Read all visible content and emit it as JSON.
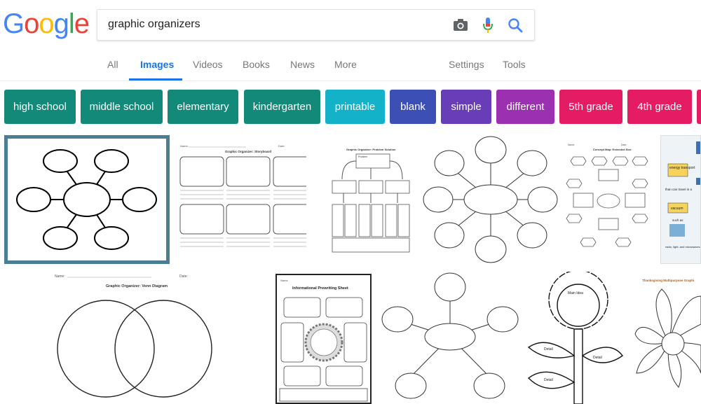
{
  "logo": {
    "letters": [
      "G",
      "o",
      "o",
      "g",
      "l",
      "e"
    ],
    "colors": [
      "#4285F4",
      "#EA4335",
      "#FBBC05",
      "#4285F4",
      "#34A853",
      "#EA4335"
    ]
  },
  "search": {
    "query": "graphic organizers"
  },
  "tabs": [
    {
      "label": "All"
    },
    {
      "label": "Images"
    },
    {
      "label": "Videos"
    },
    {
      "label": "Books"
    },
    {
      "label": "News"
    },
    {
      "label": "More"
    },
    {
      "label": "Settings"
    },
    {
      "label": "Tools"
    }
  ],
  "chips": [
    {
      "label": "high school",
      "color": "#13897a"
    },
    {
      "label": "middle school",
      "color": "#13897a"
    },
    {
      "label": "elementary",
      "color": "#13897a"
    },
    {
      "label": "kindergarten",
      "color": "#13897a"
    },
    {
      "label": "printable",
      "color": "#14b2c9"
    },
    {
      "label": "blank",
      "color": "#3c4fb5"
    },
    {
      "label": "simple",
      "color": "#6a3db8"
    },
    {
      "label": "different",
      "color": "#9b30b0"
    },
    {
      "label": "5th grade",
      "color": "#e31c63"
    },
    {
      "label": "4th grade",
      "color": "#e31c63"
    }
  ],
  "results": {
    "storyboard_title": "Graphic Organizer: Storyboard",
    "storyboard_name": "Name:",
    "storyboard_date": "Date:",
    "problem_title": "Graphic Organizer: Problem Solution",
    "problem_label": "Problem",
    "concept_title": "Concept Map: Extended Size",
    "concept_name": "Name",
    "concept_date": "Date",
    "science_labels": [
      "energy transport",
      "than can travel in a",
      "vacuum",
      "such as",
      "radio, light, and microwaves"
    ],
    "venn_title": "Graphic Organizer: Venn Diagram",
    "venn_name": "Name:",
    "venn_date": "Date:",
    "prewriting_title": "Informational Prewriting Sheet",
    "prewriting_name": "Name",
    "flower_main": "Main Idea",
    "flower_detail": "Detail",
    "thanksgiving_title": "Thanksgiving Multipurpose Graphi"
  }
}
